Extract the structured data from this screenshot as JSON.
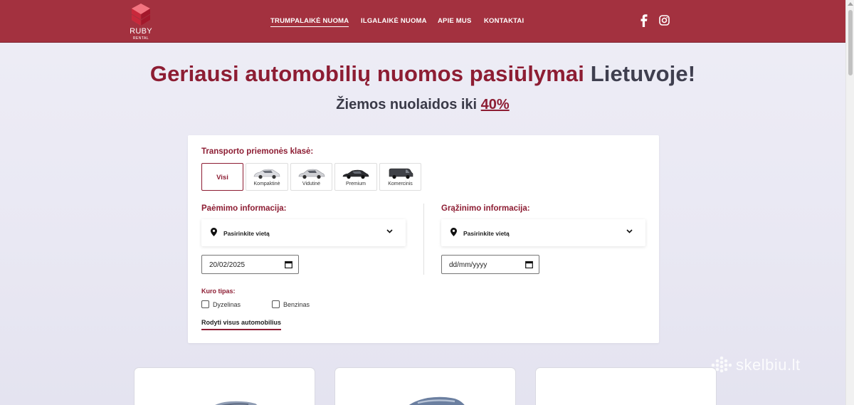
{
  "header": {
    "brand": "RUBY",
    "brand_sub": "RENTAL",
    "nav": [
      {
        "label": "TRUMPALAIKĖ NUOMA",
        "active": true
      },
      {
        "label": "ILGALAIKĖ NUOMA",
        "active": false
      },
      {
        "label": "APIE MUS",
        "active": false
      },
      {
        "label": "KONTAKTAI",
        "active": false
      }
    ],
    "social": [
      "facebook-icon",
      "instagram-icon"
    ]
  },
  "hero": {
    "title_main": "Geriausi automobilių nuomos pasiūlymai",
    "title_tail": "Lietuvoje!",
    "subtitle_prefix": "Žiemos nuolaidos iki",
    "subtitle_pct": "40%"
  },
  "form": {
    "class_label": "Transporto priemonės klasė:",
    "classes": [
      {
        "label": "Visi",
        "selected": true
      },
      {
        "label": "Kompaktinė",
        "selected": false
      },
      {
        "label": "Vidutinė",
        "selected": false
      },
      {
        "label": "Premium",
        "selected": false
      },
      {
        "label": "Komercinis",
        "selected": false
      }
    ],
    "pickup": {
      "label": "Paėmimo informacija:",
      "location_placeholder": "Pasirinkite vietą",
      "date_value": "20/02/2025"
    },
    "return": {
      "label": "Grąžinimo informacija:",
      "location_placeholder": "Pasirinkite vietą",
      "date_value": "dd/mm/yyyy"
    },
    "fuel_label": "Kuro tipas:",
    "fuel_options": [
      {
        "label": "Dyzelinas",
        "checked": false
      },
      {
        "label": "Benzinas",
        "checked": false
      }
    ],
    "show_all": "Rodyti visus automobilius"
  },
  "watermark": "skelbiu.lt",
  "colors": {
    "brand": "#a3313f",
    "accent": "#8d1d33",
    "dark_text": "#3f3f4f"
  }
}
